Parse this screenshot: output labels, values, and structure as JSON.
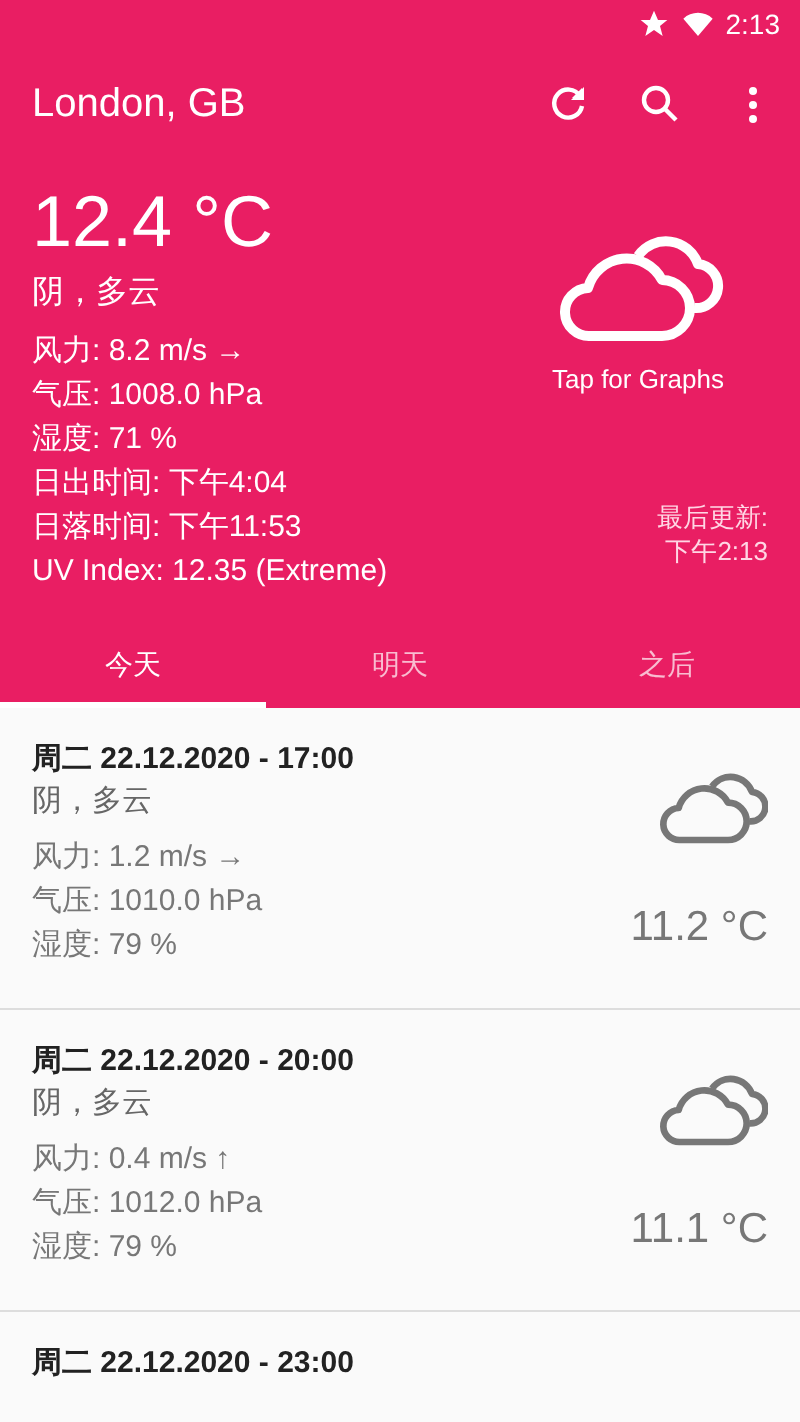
{
  "status_bar": {
    "time": "2:13"
  },
  "toolbar": {
    "title": "London, GB"
  },
  "current": {
    "temperature": "12.4 °C",
    "description": "阴，多云",
    "details": [
      "风力: 8.2 m/s →",
      "气压: 1008.0 hPa",
      "湿度: 71 %",
      "日出时间: 下午4:04",
      "日落时间: 下午11:53",
      "UV Index: 12.35 (Extreme)"
    ],
    "graphs_label": "Tap for Graphs",
    "last_update": [
      "最后更新:",
      "下午2:13"
    ]
  },
  "tabs": [
    {
      "label": "今天",
      "selected": true
    },
    {
      "label": "明天",
      "selected": false
    },
    {
      "label": "之后",
      "selected": false
    }
  ],
  "forecast": [
    {
      "date": "周二 22.12.2020 - 17:00",
      "description": "阴，多云",
      "details": [
        "风力: 1.2 m/s →",
        "气压: 1010.0 hPa",
        "湿度: 79 %"
      ],
      "temperature": "11.2 °C"
    },
    {
      "date": "周二 22.12.2020 - 20:00",
      "description": "阴，多云",
      "details": [
        "风力: 0.4 m/s ↑",
        "气压: 1012.0 hPa",
        "湿度: 79 %"
      ],
      "temperature": "11.1 °C"
    },
    {
      "date": "周二 22.12.2020 - 23:00"
    }
  ]
}
